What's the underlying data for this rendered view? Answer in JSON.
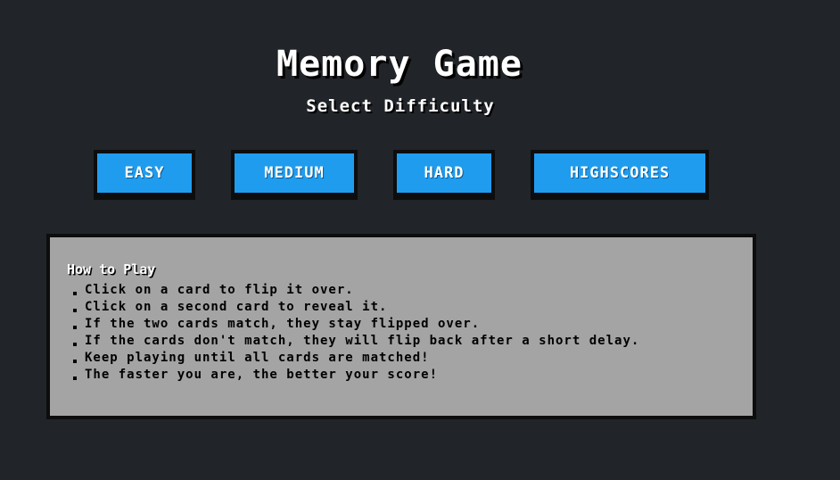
{
  "header": {
    "title": "Memory Game",
    "subtitle": "Select Difficulty"
  },
  "buttons": {
    "easy": "EASY",
    "medium": "MEDIUM",
    "hard": "HARD",
    "highscores": "HIGHSCORES"
  },
  "how_to_play": {
    "title": "How to Play",
    "items": [
      "Click on a card to flip it over.",
      "Click on a second card to reveal it.",
      "If the two cards match, they stay flipped over.",
      "If the cards don't match, they will flip back after a short delay.",
      "Keep playing until all cards are matched!",
      "The faster you are, the better your score!"
    ]
  },
  "colors": {
    "background": "#212428",
    "button": "#209cee",
    "panel": "#a4a4a4"
  }
}
